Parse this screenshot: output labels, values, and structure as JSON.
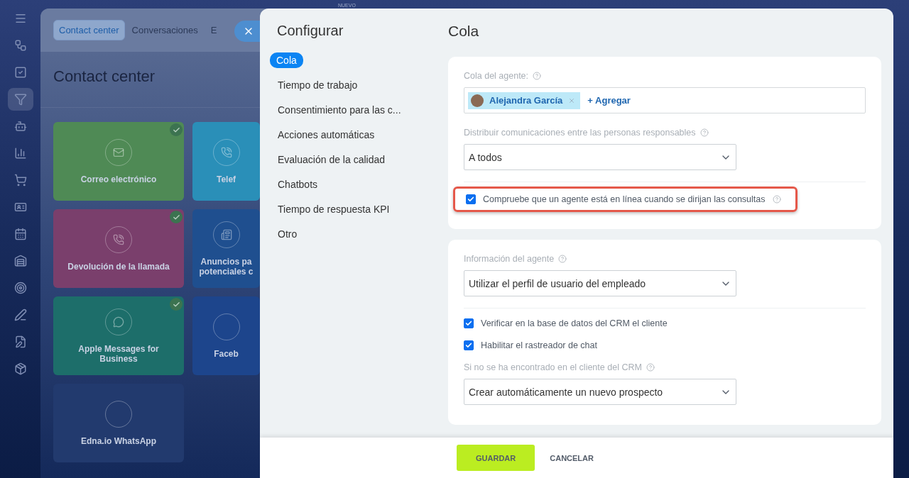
{
  "sidebar": {
    "items": [
      {
        "selected": false
      },
      {
        "selected": false
      },
      {
        "selected": false
      },
      {
        "selected": true
      },
      {
        "selected": false
      },
      {
        "selected": false
      },
      {
        "selected": false
      },
      {
        "selected": false
      },
      {
        "selected": false
      },
      {
        "selected": false
      },
      {
        "selected": false
      },
      {
        "selected": false
      },
      {
        "selected": false
      },
      {
        "selected": false
      }
    ]
  },
  "top_tag": "NUEVO",
  "background_page": {
    "tabs": [
      {
        "label": "Contact center",
        "selected": true
      },
      {
        "label": "Conversaciones",
        "selected": false
      },
      {
        "label": "E",
        "selected": false
      }
    ],
    "title": "Contact center",
    "tiles": [
      {
        "label": "Correo electrónico",
        "color": "#4f8a55",
        "checked": true
      },
      {
        "label": "Telef",
        "color": "#2a8fb8",
        "checked": false
      },
      {
        "label": "Devolución de la llamada",
        "color": "#7a3f6c",
        "checked": true
      },
      {
        "label": "Anuncios pa potenciales c",
        "color": "#1f4f8f",
        "checked": false
      },
      {
        "label": "Apple Messages for Business",
        "color": "#1d6e6a",
        "checked": true
      },
      {
        "label": "Faceb",
        "color": "#1d458c",
        "checked": false
      },
      {
        "label": "Edna.io WhatsApp",
        "color": "#223a6e",
        "checked": false
      }
    ]
  },
  "slider": {
    "title": "Configurar",
    "nav": [
      {
        "label": "Cola",
        "selected": true
      },
      {
        "label": "Tiempo de trabajo",
        "selected": false
      },
      {
        "label": "Consentimiento para las c...",
        "selected": false
      },
      {
        "label": "Acciones automáticas",
        "selected": false
      },
      {
        "label": "Evaluación de la calidad",
        "selected": false
      },
      {
        "label": "Chatbots",
        "selected": false
      },
      {
        "label": "Tiempo de respuesta KPI",
        "selected": false
      },
      {
        "label": "Otro",
        "selected": false
      }
    ],
    "heading": "Cola",
    "sections": [
      {
        "rows": [
          {
            "kind": "people",
            "label": "Cola del agente:",
            "people": [
              "Alejandra García"
            ],
            "add": "+ Agregar"
          },
          {
            "kind": "select",
            "label": "Distribuir comunicaciones entre las personas responsables",
            "value": "A todos"
          },
          {
            "kind": "divider"
          },
          {
            "kind": "checkbox",
            "label": "Compruebe que un agente está en línea cuando se dirijan las consultas",
            "checked": true,
            "help": true,
            "highlighted": true
          }
        ]
      },
      {
        "rows": [
          {
            "kind": "select",
            "label": "Información del agente",
            "value": "Utilizar el perfil de usuario del empleado"
          },
          {
            "kind": "divider"
          },
          {
            "kind": "checkbox",
            "label": "Verificar en la base de datos del CRM el cliente",
            "checked": true,
            "help": false,
            "highlighted": false
          },
          {
            "kind": "checkbox",
            "label": "Habilitar el rastreador de chat",
            "checked": true,
            "help": false,
            "highlighted": false
          },
          {
            "kind": "select",
            "label": "Si no se ha encontrado en el cliente del CRM",
            "value": "Crear automáticamente un nuevo prospecto"
          }
        ]
      }
    ],
    "buttons": [
      {
        "label": "GUARDAR",
        "kind": "primary"
      },
      {
        "label": "CANCELAR",
        "kind": "link"
      }
    ]
  }
}
